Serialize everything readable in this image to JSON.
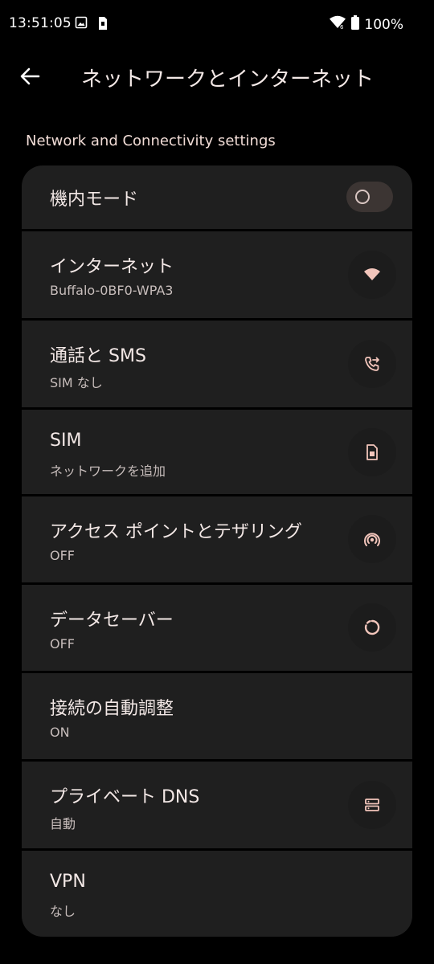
{
  "status_bar": {
    "time": "13:51:05",
    "battery": "100%"
  },
  "appbar": {
    "title": "ネットワークとインターネット"
  },
  "section": {
    "header": "Network and Connectivity settings"
  },
  "items": [
    {
      "title": "機内モード",
      "summary": "",
      "control": "toggle",
      "checked": false
    },
    {
      "title": "インターネット",
      "summary": "Buffalo-0BF0-WPA3",
      "icon": "wifi-icon"
    },
    {
      "title": "通話と SMS",
      "summary": "SIM なし",
      "icon": "phone-forwarded-icon"
    },
    {
      "title": "SIM",
      "summary": "ネットワークを追加",
      "icon": "sim-card-icon"
    },
    {
      "title": "アクセス ポイントとテザリング",
      "summary": "OFF",
      "icon": "hotspot-icon"
    },
    {
      "title": "データセーバー",
      "summary": "OFF",
      "icon": "data-saver-icon"
    },
    {
      "title": "接続の自動調整",
      "summary": "ON"
    },
    {
      "title": "プライベート DNS",
      "summary": "自動",
      "icon": "dns-icon"
    },
    {
      "title": "VPN",
      "summary": "なし"
    }
  ],
  "colors": {
    "background": "#000000",
    "card": "#1f1f1f",
    "text_primary": "#f3e8e6",
    "text_secondary": "#c7bdbb",
    "accent": "#f2c5bb"
  }
}
